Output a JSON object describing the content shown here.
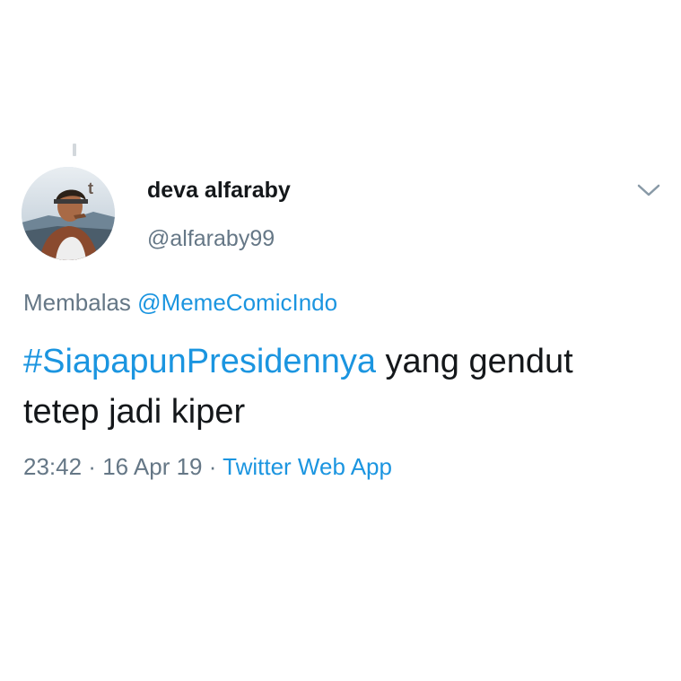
{
  "tweet": {
    "author": {
      "display_name": "deva alfaraby",
      "handle": "@alfaraby99",
      "avatar_icon": "user-avatar-photo"
    },
    "menu_icon": "chevron-down-icon",
    "reply": {
      "prefix": "Membalas",
      "mention": "@MemeComicIndo"
    },
    "text": {
      "hashtag": "#SiapapunPresidennya",
      "rest": " yang gendut tetep jadi kiper"
    },
    "meta": {
      "time": "23:42",
      "separator": " · ",
      "date": "16 Apr 19",
      "source": "Twitter Web App"
    }
  },
  "colors": {
    "link": "#1b95e0",
    "secondary_text": "#657786",
    "primary_text": "#14171a",
    "background": "#ffffff"
  }
}
